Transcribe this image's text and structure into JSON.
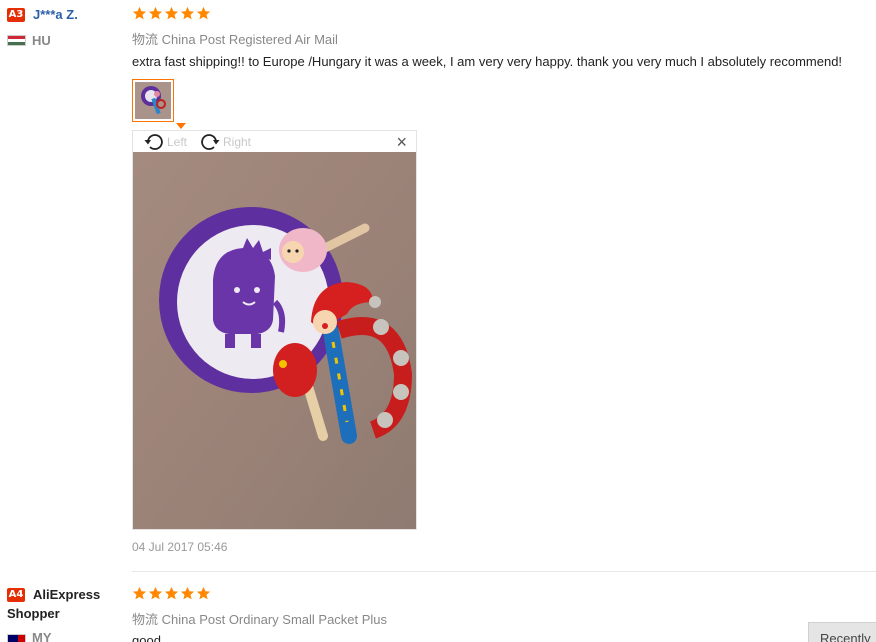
{
  "reviews": [
    {
      "level": "A3",
      "user": "J***a Z.",
      "country": "HU",
      "rating": 5,
      "shipping": "物流 China Post Registered Air Mail",
      "text": "extra fast shipping!! to Europe /Hungary it was a week, I am very very happy. thank you very much I absolutely recommend!",
      "date": "04 Jul 2017 05:46"
    },
    {
      "level": "A4",
      "user": "AliExpress Shopper",
      "country": "MY",
      "rating": 5,
      "shipping": "物流 China Post Ordinary Small Packet Plus",
      "text": "good"
    }
  ],
  "viewer": {
    "rotate_left": "Left",
    "rotate_right": "Right",
    "close": "×"
  },
  "buttons": {
    "recently": "Recently"
  },
  "colors": {
    "badge": "#e62e04",
    "star": "#ff8800",
    "thumb_border": "#ff7300",
    "username": "#2c5fa8"
  },
  "icons": {
    "rotate_left": "rotate-left-icon",
    "rotate_right": "rotate-right-icon",
    "close": "close-icon",
    "star": "star-icon"
  }
}
